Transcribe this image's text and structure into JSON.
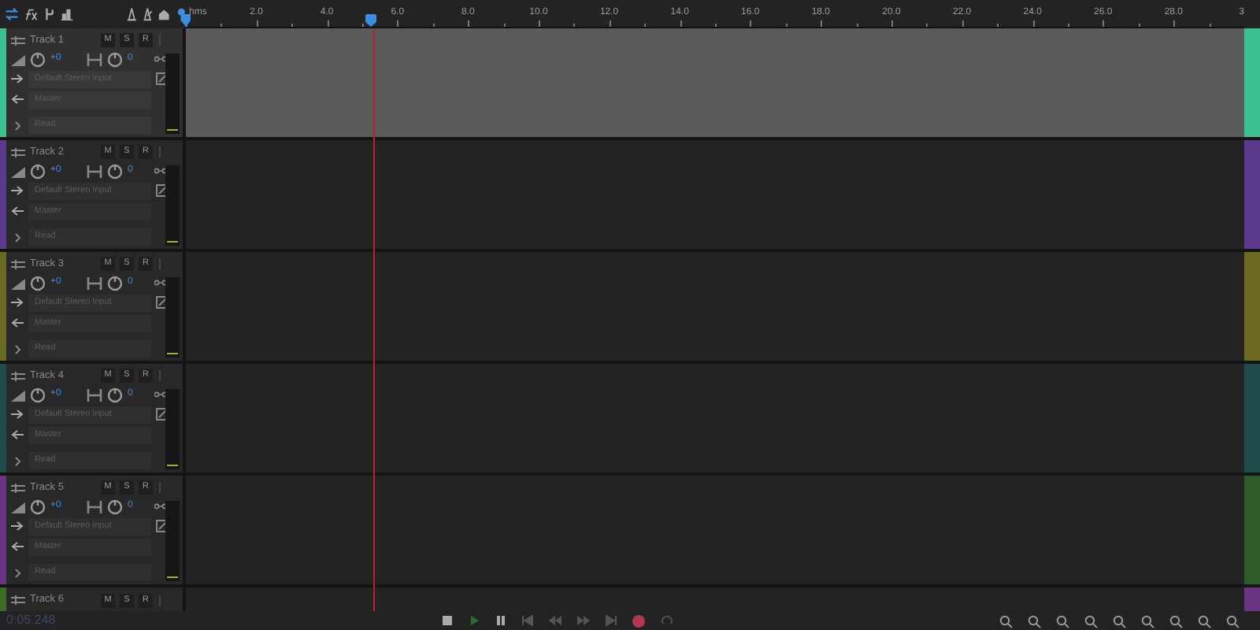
{
  "ruler": {
    "labels": [
      "hms",
      "2.0",
      "4.0",
      "6.0",
      "8.0",
      "10.0",
      "12.0",
      "14.0",
      "16.0",
      "18.0",
      "20.0",
      "22.0",
      "24.0",
      "26.0",
      "28.0",
      "3"
    ]
  },
  "playhead": {
    "level": 0.175
  },
  "tracks": [
    {
      "name": "Track 1",
      "selected": true,
      "color": "#3cc08e",
      "overview": {
        "color": "#3cc08e"
      },
      "buttons": [
        "M",
        "S",
        "R"
      ],
      "volume": "+0",
      "pan": "0",
      "input": "Default Stereo Input",
      "output": "Master",
      "automation": "Read"
    },
    {
      "name": "Track 2",
      "selected": false,
      "color": "#5b3a8e",
      "overview": {
        "color": "#5b3a8e"
      },
      "buttons": [
        "M",
        "S",
        "R"
      ],
      "volume": "+0",
      "pan": "0",
      "input": "Default Stereo Input",
      "output": "Master",
      "automation": "Read"
    },
    {
      "name": "Track 3",
      "selected": false,
      "color": "#6b6a22",
      "overview": {
        "color": "#6b6a22"
      },
      "buttons": [
        "M",
        "S",
        "R"
      ],
      "volume": "+0",
      "pan": "0",
      "input": "Default Stereo Input",
      "output": "Master",
      "automation": "Read"
    },
    {
      "name": "Track 4",
      "selected": false,
      "color": "#1f4d4a",
      "overview": {
        "color": "#1f4d4a"
      },
      "buttons": [
        "M",
        "S",
        "R"
      ],
      "volume": "+0",
      "pan": "0",
      "input": "Default Stereo Input",
      "output": "Master",
      "automation": "Read"
    },
    {
      "name": "Track 5",
      "selected": false,
      "color": "#6a3580",
      "overview": {
        "color": "#2f5a2a"
      },
      "buttons": [
        "M",
        "S",
        "R"
      ],
      "volume": "+0",
      "pan": "0",
      "input": "Default Stereo Input",
      "output": "Master",
      "automation": "Read"
    },
    {
      "name": "Track 6",
      "selected": false,
      "color": "#3d6b2a",
      "overview": {
        "color": "#6a3580"
      },
      "buttons": [
        "M",
        "S",
        "R"
      ]
    }
  ],
  "time": "0:05.248"
}
